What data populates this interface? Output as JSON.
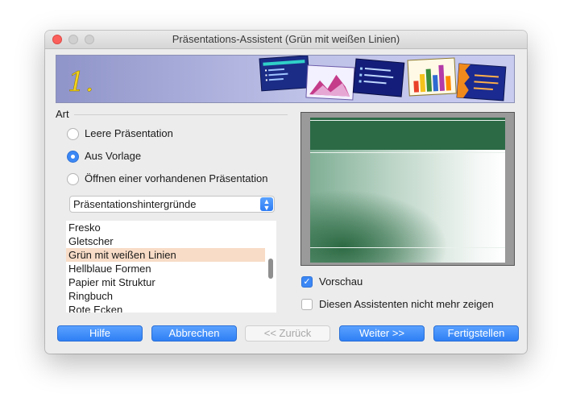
{
  "window": {
    "title": "Präsentations-Assistent (Grün mit weißen Linien)"
  },
  "banner": {
    "step_number": "1."
  },
  "art_section": {
    "label": "Art",
    "options": [
      {
        "label": "Leere Präsentation",
        "selected": false
      },
      {
        "label": "Aus Vorlage",
        "selected": true
      },
      {
        "label": "Öffnen einer vorhandenen Präsentation",
        "selected": false
      }
    ]
  },
  "category_select": {
    "value": "Präsentationshintergründe"
  },
  "template_list": {
    "items": [
      "Fresko",
      "Gletscher",
      "Grün mit weißen Linien",
      "Hellblaue Formen",
      "Papier mit Struktur",
      "Ringbuch",
      "Rote Ecken"
    ],
    "selected_index": 2
  },
  "options": {
    "preview_label": "Vorschau",
    "preview_checked": true,
    "dont_show_label": "Diesen Assistenten nicht mehr zeigen",
    "dont_show_checked": false
  },
  "buttons": {
    "help": "Hilfe",
    "cancel": "Abbrechen",
    "back": "<< Zurück",
    "next": "Weiter >>",
    "finish": "Fertigstellen"
  },
  "colors": {
    "accent": "#3b87f5",
    "list_selection": "#f8dcc7",
    "preview_green": "#2b6a45",
    "banner": "#bfc2e8"
  },
  "icons": [
    "check-icon",
    "chevron-updown-icon",
    "close-icon",
    "minimize-icon",
    "zoom-icon"
  ]
}
